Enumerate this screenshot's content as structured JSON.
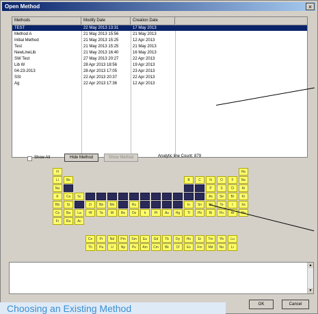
{
  "window": {
    "title": "Open Method",
    "close_label": "×"
  },
  "methods_table": {
    "columns": [
      "Methods",
      "Modify Date",
      "Creation Date"
    ],
    "rows": [
      {
        "name": "TEST",
        "modified": "22 May 2013 13:31",
        "created": "17 May 2013",
        "selected": true
      },
      {
        "name": "Method A",
        "modified": "21 May 2013 15:56",
        "created": "21 May 2013",
        "selected": false
      },
      {
        "name": "Initial Method",
        "modified": "21 May 2013 15:25",
        "created": "12 Apr 2013",
        "selected": false
      },
      {
        "name": "Test",
        "modified": "21 May 2013 15:25",
        "created": "21 May 2013",
        "selected": false
      },
      {
        "name": "NewLineLib",
        "modified": "21 May 2013 16:40",
        "created": "16 May 2013",
        "selected": false
      },
      {
        "name": "SW Test",
        "modified": "27 May 2013 20:27",
        "created": "22 Apr 2013",
        "selected": false
      },
      {
        "name": "Lib W",
        "modified": "28 Apr 2013 18:56",
        "created": "19 Apr 2013",
        "selected": false
      },
      {
        "name": "04-23-2013",
        "modified": "28 Apr 2013 17:05",
        "created": "23 Apr 2013",
        "selected": false
      },
      {
        "name": "SSI",
        "modified": "22 Apr 2013 20:37",
        "created": "22 Apr 2013",
        "selected": false
      },
      {
        "name": "Ag",
        "modified": "22 Apr 2013 17:36",
        "created": "12 Apr 2013",
        "selected": false
      }
    ]
  },
  "controls": {
    "show_all_label": "Show All",
    "hide_method_label": "Hide Method",
    "show_method_label": "Show Method",
    "analytic_line_count": "Analytic line Count: 879"
  },
  "periodic_table": {
    "rows": [
      [
        "H",
        "",
        "",
        "",
        "",
        "",
        "",
        "",
        "",
        "",
        "",
        "",
        "",
        "",
        "",
        "",
        "",
        "He"
      ],
      [
        "Li",
        "Be",
        "",
        "",
        "",
        "",
        "",
        "",
        "",
        "",
        "",
        "",
        "B",
        "C",
        "N",
        "O",
        "F",
        "Ne"
      ],
      [
        "Na",
        "Mg",
        "",
        "",
        "",
        "",
        "",
        "",
        "",
        "",
        "",
        "",
        "Al",
        "Si",
        "P",
        "S",
        "Cl",
        "Ar"
      ],
      [
        "K",
        "Ca",
        "Sc",
        "Ti",
        "V",
        "Cr",
        "Mn",
        "Fe",
        "Co",
        "Ni",
        "Cu",
        "Zn",
        "Ga",
        "Ge",
        "As",
        "Se",
        "Br",
        "Kr"
      ],
      [
        "Rb",
        "Sr",
        "Y",
        "Zr",
        "Nb",
        "Mo",
        "Tc",
        "Ru",
        "Rh",
        "Pd",
        "Ag",
        "Cd",
        "In",
        "Sn",
        "Sb",
        "Te",
        "I",
        "Xe"
      ],
      [
        "Cs",
        "Ba",
        "La",
        "Hf",
        "Ta",
        "W",
        "Re",
        "Os",
        "Ir",
        "Pt",
        "Au",
        "Hg",
        "Tl",
        "Pb",
        "Bi",
        "Po",
        "At",
        "Rn"
      ],
      [
        "Fr",
        "Ra",
        "Ac",
        "",
        "",
        "",
        "",
        "",
        "",
        "",
        "",
        "",
        "",
        "",
        "",
        "",
        "",
        ""
      ]
    ],
    "lanthanides": [
      "Ce",
      "Pr",
      "Nd",
      "Pm",
      "Sm",
      "Eu",
      "Gd",
      "Tb",
      "Dy",
      "Ho",
      "Er",
      "Tm",
      "Yb",
      "Lu"
    ],
    "actinides": [
      "Th",
      "Pa",
      "U",
      "Np",
      "Pu",
      "Am",
      "Cm",
      "Bk",
      "Cf",
      "Es",
      "Fm",
      "Md",
      "No",
      "Lr"
    ],
    "selected_elements": [
      "Mg",
      "Al",
      "Si",
      "Ti",
      "V",
      "Cr",
      "Mn",
      "Fe",
      "Co",
      "Ni",
      "Cu",
      "Zn",
      "Ga",
      "Ge",
      "Y",
      "Tc",
      "Rh",
      "Pd",
      "Ag",
      "Cd"
    ],
    "colors": {
      "available": "#ffff6a",
      "selected": "#2a2a5a"
    }
  },
  "buttons": {
    "ok_label": "OK",
    "cancel_label": "Cancel"
  },
  "message_box": {
    "text": ""
  },
  "caption": {
    "text": "Choosing an Existing Method"
  }
}
